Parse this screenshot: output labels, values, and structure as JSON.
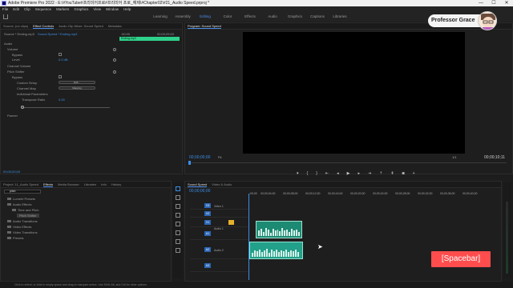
{
  "window": {
    "title": "Adobe Premiere Pro 2022 - E:\\#YouTube#프리미어프로#프리미어 프로_예제\\#Chapter02\\#21_Audio Speed.prproj *",
    "controls": [
      "—",
      "☐",
      "✕"
    ]
  },
  "menu": [
    "File",
    "Edit",
    "Clip",
    "Sequence",
    "Markers",
    "Graphics",
    "View",
    "Window",
    "Help"
  ],
  "workspaces": [
    "Learning",
    "Assembly",
    "Editing",
    "Color",
    "Effects",
    "Audio",
    "Graphics",
    "Captions",
    "Libraries"
  ],
  "workspace_active": "Editing",
  "effect_controls": {
    "tabs": [
      "Source: (no clips)",
      "Effect Controls",
      "Audio Clip Mixer: Sound Speed",
      "Metadata"
    ],
    "source": "Source * Ending.mp3",
    "sequence": "Sound Speed * Ending.mp3",
    "time_start": ":00:00",
    "time_end": "00;00;05;00",
    "clip_name": "Ending.mp3",
    "section_audio": "Audio",
    "volume": "Volume",
    "bypass": "Bypass",
    "level": "Level",
    "level_value": "0.0 dB",
    "channel_volume": "Channel Volume",
    "pitch_shifter": "Pitch Shifter",
    "custom_setup": "Custom Setup",
    "edit_button": "Edit...",
    "channel_map": "Channel Map",
    "channel_map_button": "Mapping",
    "individual_params": "Individual Parameters",
    "transpose_ratio": "Transpose Ratio",
    "transpose_value": "0.00",
    "panner": "Panner",
    "timecode": "00;00;00;00"
  },
  "program": {
    "title": "Program: Sound Speed",
    "timecode": "00;00;00;00",
    "fit": "Fit",
    "ratio": "1/1",
    "duration": "00;00;10;11"
  },
  "project": {
    "tabs": [
      "Project: 11_Audio Speed",
      "Effects",
      "Media Browser",
      "Libraries",
      "Info",
      "History"
    ],
    "search_value": "pitch",
    "items": [
      "Lumetri Presets",
      "Audio Effects",
      "Time and Pitch",
      "Pitch Shifter",
      "Audio Transitions",
      "Video Effects",
      "Video Transitions",
      "Presets"
    ]
  },
  "timeline": {
    "tabs": [
      "Sound Speed",
      "Video & Audio"
    ],
    "timecode": "00;00;00;00",
    "ruler": [
      ":00;00",
      "00;00;04;00",
      "00;00;08;00",
      "00;00;12;00",
      "00;00;16;00",
      "00;00;20;00",
      "00;00;24;00",
      "00;00;28;00",
      "00;00;32;00",
      "00;00;36;00",
      "00;00;40;00"
    ],
    "tracks": [
      "V3",
      "V2",
      "V1",
      "A1",
      "A2",
      "A3"
    ],
    "track_names": {
      "v1": "Video 1",
      "a1": "Audio 1",
      "a2": "Audio 2"
    }
  },
  "status": "Click to select, or click in empty space and drag to marquee select. Use Shift, Alt, and Ctrl for other options.",
  "overlay": {
    "professor": "Professor Grace",
    "key_hint": "[Spacebar]"
  },
  "colors": {
    "accent": "#3a8ee6",
    "clip_audio": "#22a089",
    "hint": "#ff4d4d",
    "label_yellow": "#e6b12b"
  }
}
